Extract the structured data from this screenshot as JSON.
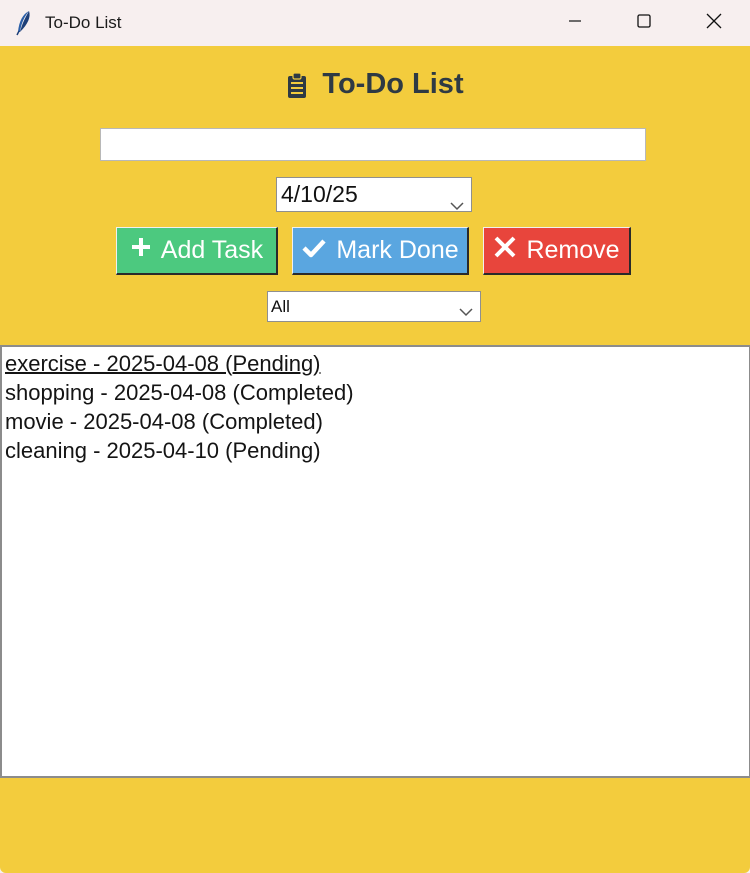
{
  "window": {
    "title": "To-Do List",
    "icon": "feather-icon",
    "controls": [
      "minimize-icon",
      "maximize-icon",
      "close-icon"
    ]
  },
  "header": {
    "icon": "clipboard-icon",
    "title": "To-Do List"
  },
  "task_input": {
    "value": "",
    "placeholder": ""
  },
  "date_picker": {
    "value": "4/10/25"
  },
  "buttons": {
    "add": {
      "label": "Add Task",
      "icon": "plus-icon",
      "color": "#4cc97f"
    },
    "done": {
      "label": "Mark Done",
      "icon": "check-icon",
      "color": "#5aa6e0"
    },
    "remove": {
      "label": "Remove",
      "icon": "x-icon",
      "color": "#e8453c"
    }
  },
  "filter": {
    "value": "All"
  },
  "tasks": [
    {
      "text": "exercise - 2025-04-08 (Pending)",
      "active": true
    },
    {
      "text": "shopping - 2025-04-08 (Completed)",
      "active": false
    },
    {
      "text": "movie - 2025-04-08 (Completed)",
      "active": false
    },
    {
      "text": "cleaning - 2025-04-10 (Pending)",
      "active": false
    }
  ],
  "colors": {
    "background": "#f3cc3d",
    "titlebar": "#f7efef",
    "heading_text": "#2e3a44"
  }
}
